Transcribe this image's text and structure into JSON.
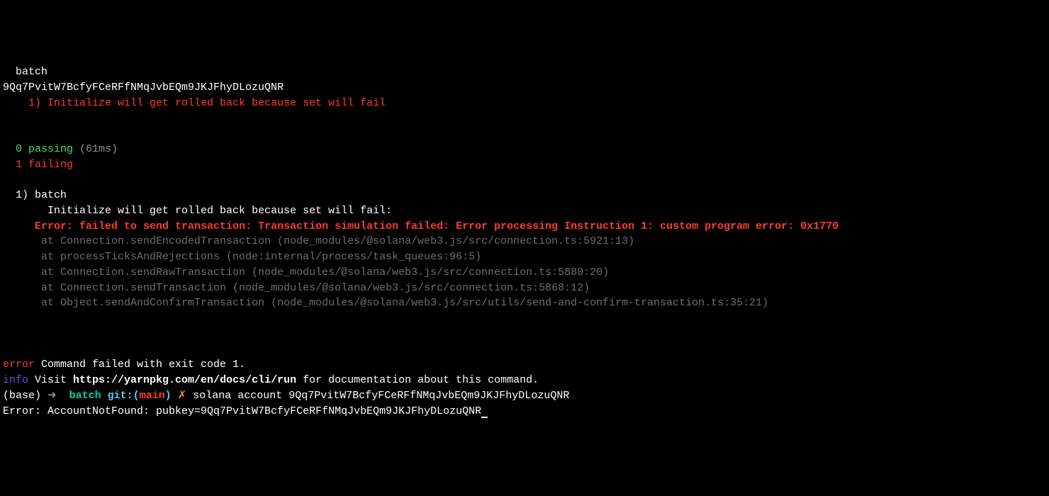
{
  "colors": {
    "background": "#000000",
    "white": "#ffffff",
    "red": "#ff3b30",
    "green": "#4cd964",
    "gray": "#8e8e93",
    "dimgray": "#6e6e73",
    "blue": "#5856d6",
    "cyan": "#5ac8fa",
    "teal": "#00d1b2",
    "orange": "#ff9500"
  },
  "test_suite": {
    "indent": "  ",
    "name": "batch",
    "account_id": "9Qq7PvitW7BcfyFCeRFfNMqJvbEQm9JKJFhyDLozuQNR",
    "failing_indent": "    ",
    "failing_marker": "1) ",
    "failing_title": "Initialize will get rolled back because set will fail"
  },
  "summary": {
    "indent": "  ",
    "passing_count": "0",
    "passing_word": " passing",
    "passing_time": " (61ms)",
    "failing_count": "1",
    "failing_word": " failing"
  },
  "failure": {
    "indent1": "  ",
    "marker": "1) ",
    "suite": "batch",
    "indent2": "       ",
    "title": "Initialize will get rolled back because set will fail:",
    "error_indent": "     ",
    "error_msg": "Error: failed to send transaction: Transaction simulation failed: Error processing Instruction 1: custom program error: 0x1770",
    "stack_indent": "      ",
    "stack": [
      "at Connection.sendEncodedTransaction (node_modules/@solana/web3.js/src/connection.ts:5921:13)",
      "at processTicksAndRejections (node:internal/process/task_queues:96:5)",
      "at Connection.sendRawTransaction (node_modules/@solana/web3.js/src/connection.ts:5880:20)",
      "at Connection.sendTransaction (node_modules/@solana/web3.js/src/connection.ts:5868:12)",
      "at Object.sendAndConfirmTransaction (node_modules/@solana/web3.js/src/utils/send-and-confirm-transaction.ts:35:21)"
    ]
  },
  "yarn": {
    "error_label": "error",
    "error_msg": " Command failed with exit code 1.",
    "info_label": "info",
    "info_prefix": " Visit ",
    "info_url": "https://yarnpkg.com/en/docs/cli/run",
    "info_suffix": " for documentation about this command."
  },
  "prompt": {
    "env": "(base)",
    "arrow": " ➜  ",
    "dir": "batch",
    "git_label": " git:(",
    "git_branch": "main",
    "git_close": ")",
    "dirty": " ✗",
    "command": " solana account 9Qq7PvitW7BcfyFCeRFfNMqJvbEQm9JKJFhyDLozuQNR"
  },
  "result": {
    "error": "Error: AccountNotFound: pubkey=9Qq7PvitW7BcfyFCeRFfNMqJvbEQm9JKJFhyDLozuQNR"
  }
}
